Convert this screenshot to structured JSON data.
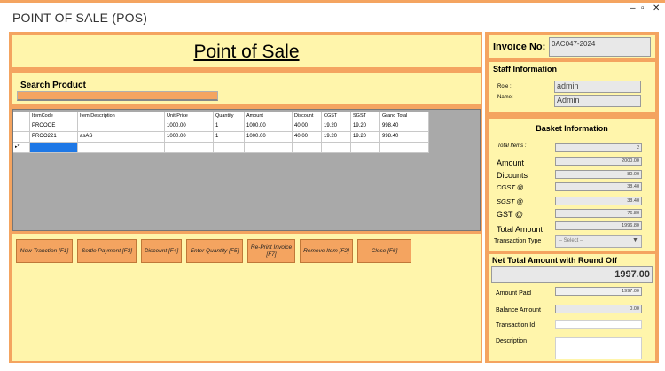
{
  "window": {
    "title": "POINT OF SALE (POS)",
    "minimize": "–",
    "maximize": "▫",
    "close": "✕"
  },
  "header": {
    "title": "Point of Sale"
  },
  "search": {
    "label": "Search Product",
    "value": ""
  },
  "table": {
    "columns": [
      "ItemCode",
      "Item Description",
      "Unit Price",
      "Quantity",
      "Amount",
      "Discount",
      "CGST",
      "SGST",
      "Grand Total"
    ],
    "rows": [
      [
        "PROOOE",
        "",
        "1000.00",
        "1",
        "1000.00",
        "40.00",
        "19.20",
        "19.20",
        "998.40"
      ],
      [
        "PROO221",
        "asAS",
        "1000.00",
        "1",
        "1000.00",
        "40.00",
        "19.20",
        "19.20",
        "998.40"
      ]
    ],
    "new_row_marker": "▸*"
  },
  "buttons": [
    {
      "label": "New Tranction [F1]"
    },
    {
      "label": "Settle Payment [F3]"
    },
    {
      "label": "Discount [F4]"
    },
    {
      "label": "Enter Quantity [F5]"
    },
    {
      "label": "Re-Print Invoice [F7]"
    },
    {
      "label": "Remove Item [F2]"
    },
    {
      "label": "Close [F6]"
    }
  ],
  "invoice": {
    "label": "Invoice No:",
    "value": "0AC047-2024"
  },
  "staff": {
    "title": "Staff Information",
    "role_label": "Role :",
    "role_value": "admin",
    "name_label": "Name:",
    "name_value": "Admin"
  },
  "basket": {
    "title": "Basket Information",
    "total_items_label": "Total Items :",
    "total_items": "2",
    "amount_label": "Amount",
    "amount": "2000.00",
    "discounts_label": "Dicounts",
    "discounts": "80.00",
    "cgst_label": "CGST @",
    "cgst": "38.40",
    "sgst_label": "SGST @",
    "sgst": "38.40",
    "gst_label": "GST @",
    "gst": "76.80",
    "total_amount_label": "Total Amount",
    "total_amount": "1996.80",
    "transaction_type_label": "Transaction Type",
    "transaction_type": "-- Select --"
  },
  "payment": {
    "net_total_label": "Net Total Amount with Round Off",
    "net_total": "1997.00",
    "amount_paid_label": "Amount Paid",
    "amount_paid": "1997.00",
    "balance_label": "Balance Amount",
    "balance": "0.00",
    "transaction_id_label": "Transaction Id",
    "description_label": "Description"
  },
  "colors": {
    "accent": "#f4a460",
    "panel": "#fff5ab"
  }
}
